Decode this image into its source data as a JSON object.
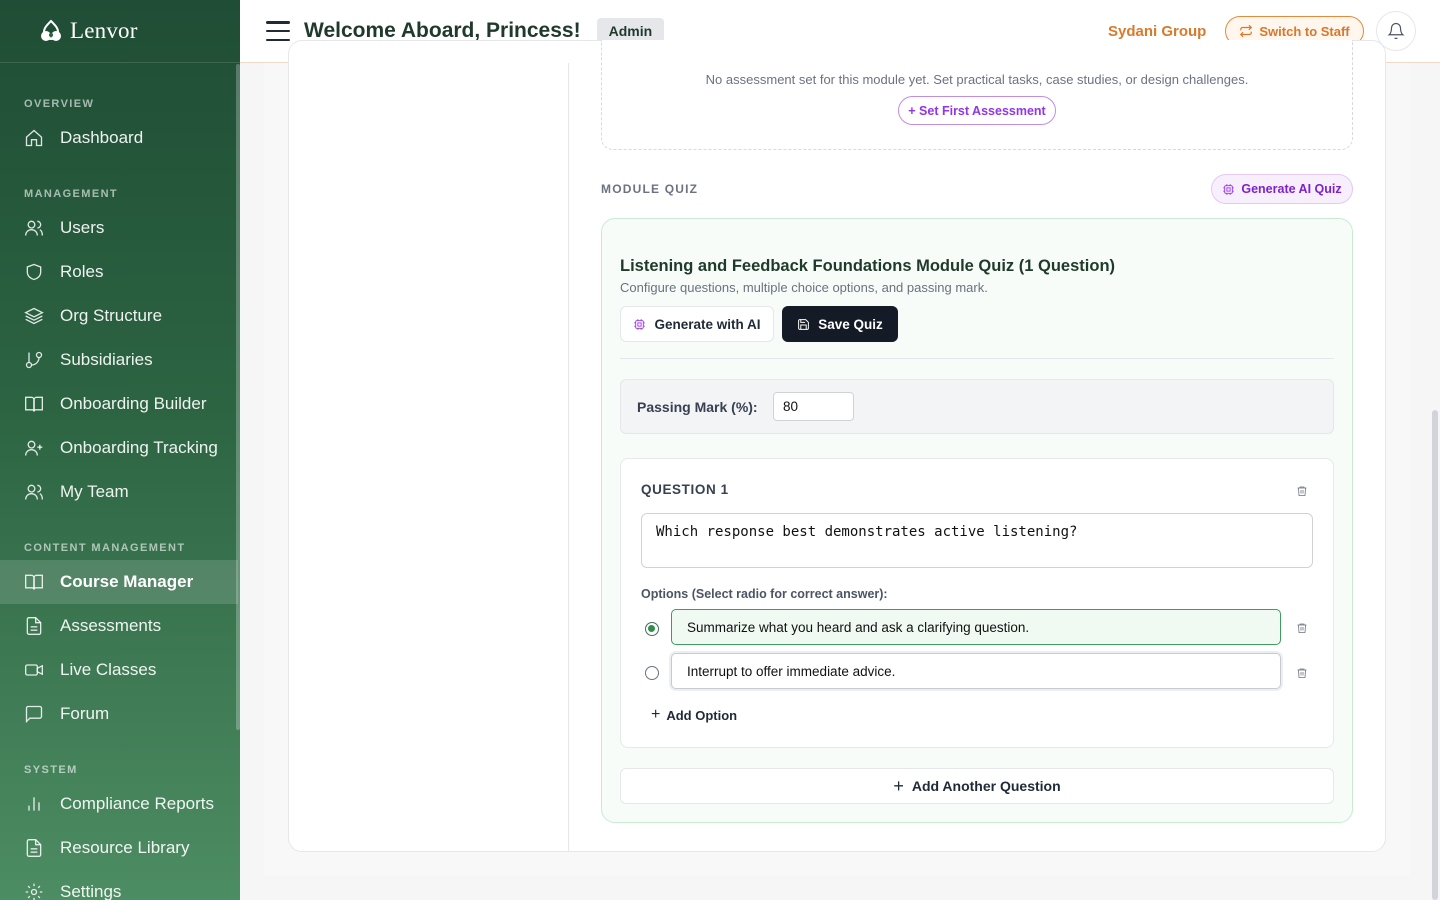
{
  "brand": {
    "name": "Lenvor"
  },
  "sidebar": {
    "sections": [
      {
        "label": "OVERVIEW"
      },
      {
        "label": "MANAGEMENT"
      },
      {
        "label": "CONTENT MANAGEMENT"
      },
      {
        "label": "SYSTEM"
      }
    ],
    "items": [
      {
        "label": "Dashboard",
        "icon": "home-icon"
      },
      {
        "label": "Users",
        "icon": "users-icon"
      },
      {
        "label": "Roles",
        "icon": "shield-icon"
      },
      {
        "label": "Org Structure",
        "icon": "layers-icon"
      },
      {
        "label": "Subsidiaries",
        "icon": "git-branch-icon"
      },
      {
        "label": "Onboarding Builder",
        "icon": "book-open-icon"
      },
      {
        "label": "Onboarding Tracking",
        "icon": "user-plus-icon"
      },
      {
        "label": "My Team",
        "icon": "users-icon"
      },
      {
        "label": "Course Manager",
        "icon": "book-open-icon",
        "active": true
      },
      {
        "label": "Assessments",
        "icon": "file-text-icon"
      },
      {
        "label": "Live Classes",
        "icon": "video-icon"
      },
      {
        "label": "Forum",
        "icon": "message-square-icon"
      },
      {
        "label": "Compliance Reports",
        "icon": "bar-chart-icon"
      },
      {
        "label": "Resource Library",
        "icon": "file-text-icon"
      },
      {
        "label": "Settings",
        "icon": "gear-icon"
      }
    ]
  },
  "header": {
    "title": "Welcome Aboard, Princess!",
    "role_badge": "Admin",
    "org_name": "Sydani Group",
    "switch_label": "Switch to Staff"
  },
  "assessment": {
    "empty_text": "No assessment set for this module yet. Set practical tasks, case studies, or design challenges.",
    "set_first_label": "+ Set First Assessment"
  },
  "module_quiz": {
    "section_label": "MODULE QUIZ",
    "generate_ai_quiz_label": "Generate AI Quiz",
    "title": "Listening and Feedback Foundations Module Quiz (1 Question)",
    "subtitle": "Configure questions, multiple choice options, and passing mark.",
    "generate_with_ai_label": "Generate with AI",
    "save_label": "Save Quiz",
    "passing_mark_label": "Passing Mark (%):",
    "passing_mark_value": "80",
    "questions": [
      {
        "number_label": "QUESTION 1",
        "text": "Which response best demonstrates active listening?",
        "options_label": "Options (Select radio for correct answer):",
        "options": [
          {
            "text": "Summarize what you heard and ask a clarifying question.",
            "correct": true
          },
          {
            "text": "Interrupt to offer immediate advice.",
            "correct": false
          }
        ],
        "add_option_label": "Add Option"
      }
    ],
    "add_question_label": "Add Another Question"
  },
  "colors": {
    "sidebar_top": "#1f4d35",
    "sidebar_bottom": "#4d8d63",
    "accent_orange": "#d97a2b",
    "accent_purple": "#9333ea",
    "correct_green": "#2f8d4e"
  }
}
